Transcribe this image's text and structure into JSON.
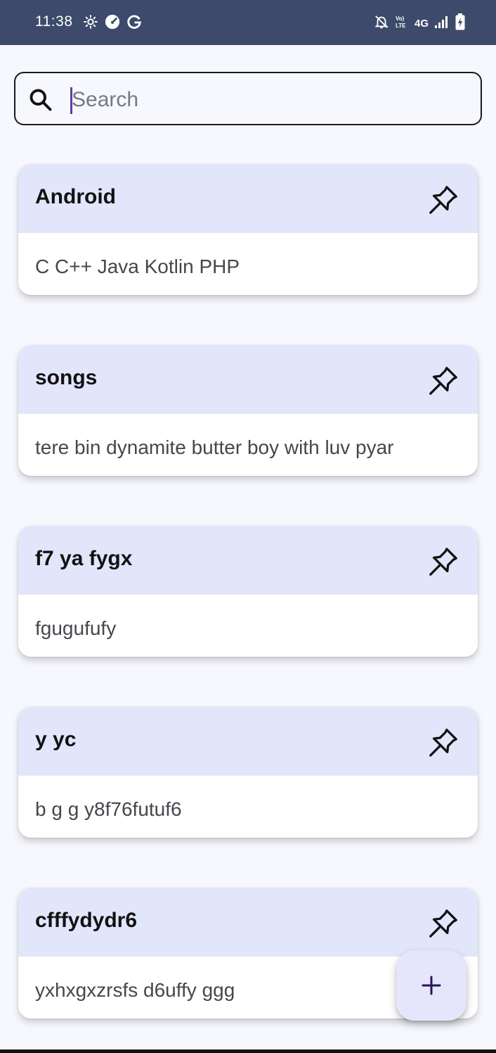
{
  "status_bar": {
    "time": "11:38",
    "left_icons": [
      "settings-gear-icon",
      "speedometer-icon",
      "google-g-icon"
    ],
    "network_text": "4G",
    "right_icons": [
      "notifications-muted-icon",
      "volte-icon",
      "signal-icon",
      "battery-charging-icon"
    ],
    "background": "#3d4a6b"
  },
  "search": {
    "placeholder": "Search",
    "value": "",
    "icon": "search-icon"
  },
  "notes": [
    {
      "title": "Android",
      "body": "C C++ Java Kotlin PHP",
      "pin_icon": "pin-icon"
    },
    {
      "title": "songs",
      "body": "tere bin dynamite butter boy with luv pyar",
      "pin_icon": "pin-icon"
    },
    {
      "title": "f7 ya fygx",
      "body": "fgugufufy",
      "pin_icon": "pin-icon"
    },
    {
      "title": "y yc",
      "body": "b g g y8f76futuf6",
      "pin_icon": "pin-icon"
    },
    {
      "title": "cfffydydr6",
      "body": "yxhxgxzrsfs d6uffy ggg",
      "pin_icon": "pin-icon"
    }
  ],
  "fab": {
    "icon": "plus-icon",
    "label": "+"
  },
  "colors": {
    "card_header": "#e2e6fa",
    "background": "#f7f8fe",
    "fab_background": "#e5e5fb",
    "fab_plus": "#2b1453",
    "caret": "#5f3e9e"
  }
}
